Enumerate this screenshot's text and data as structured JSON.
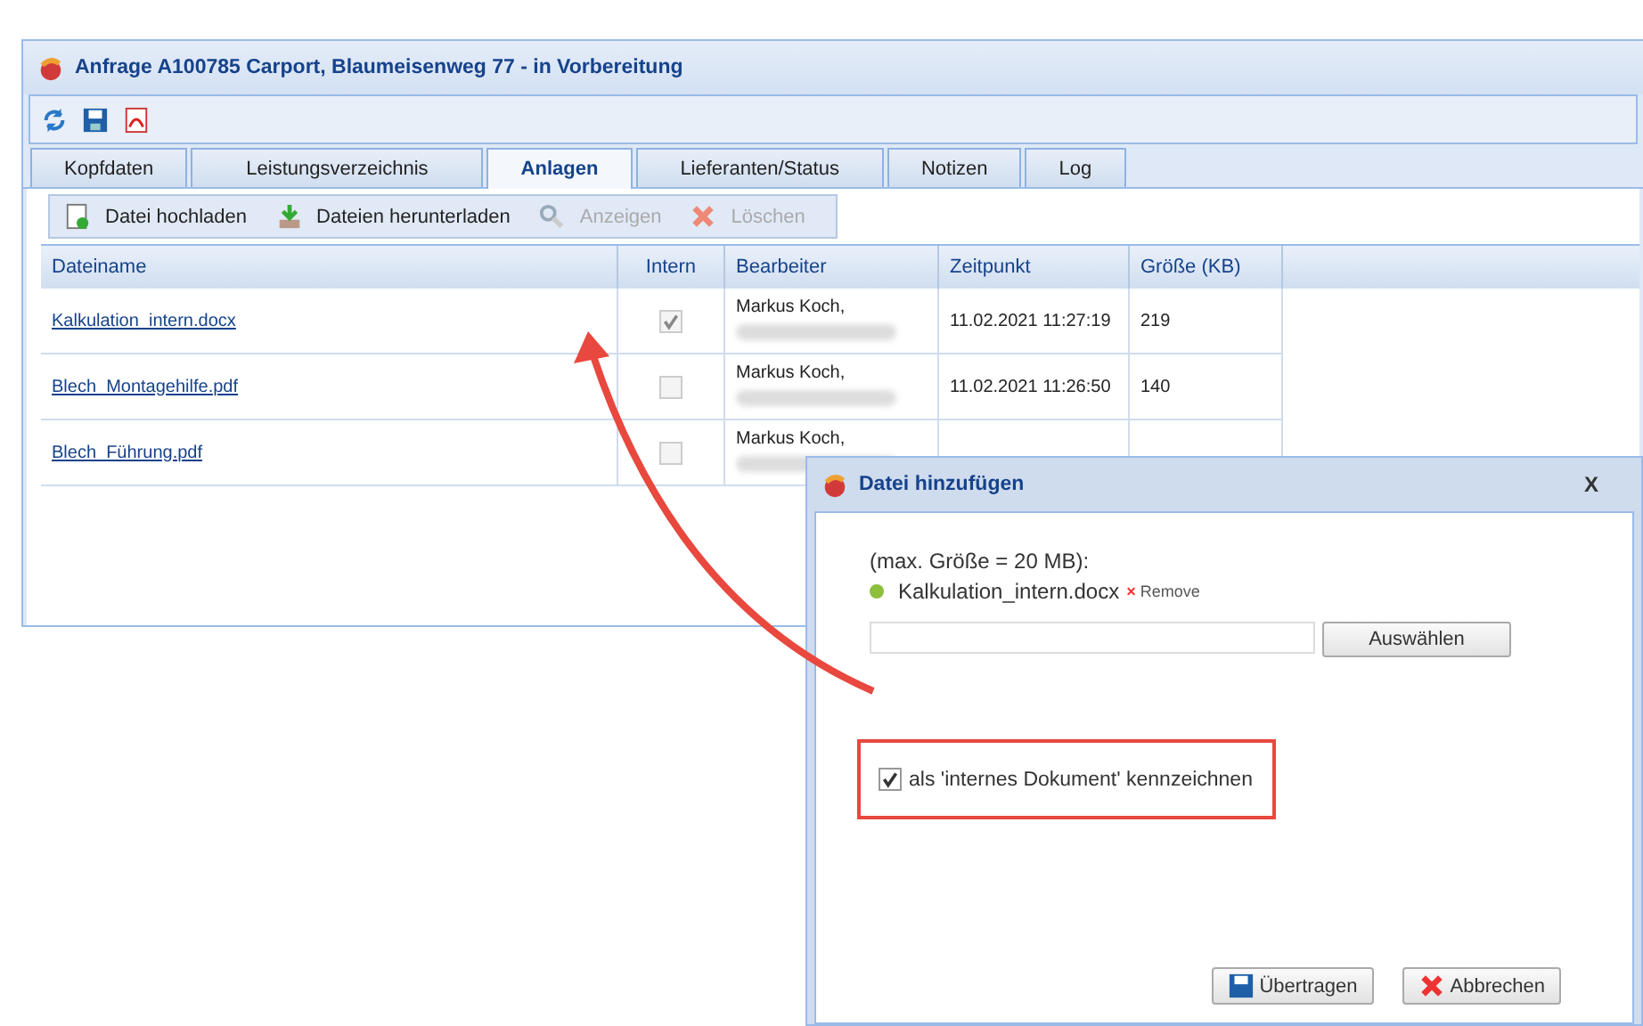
{
  "window": {
    "title": "Anfrage A100785 Carport, Blaumeisenweg 77 - in Vorbereitung"
  },
  "tabs": [
    {
      "label": "Kopfdaten",
      "selected": false
    },
    {
      "label": "Leistungsverzeichnis",
      "selected": false
    },
    {
      "label": "Anlagen",
      "selected": true
    },
    {
      "label": "Lieferanten/Status",
      "selected": false
    },
    {
      "label": "Notizen",
      "selected": false
    },
    {
      "label": "Log",
      "selected": false
    }
  ],
  "actions": [
    {
      "kind": "upload",
      "label": "Datei hochladen",
      "disabled": false
    },
    {
      "kind": "download",
      "label": "Dateien herunterladen",
      "disabled": false
    },
    {
      "kind": "view",
      "label": "Anzeigen",
      "disabled": true
    },
    {
      "kind": "delete",
      "label": "Löschen",
      "disabled": true
    }
  ],
  "table": {
    "columns": [
      "Dateiname",
      "Intern",
      "Bearbeiter",
      "Zeitpunkt",
      "Größe (KB)"
    ],
    "rows": [
      {
        "name": "Kalkulation_intern.docx",
        "checked": true,
        "editor": "Markus Koch,",
        "time": "11.02.2021 11:27:19",
        "size": "219"
      },
      {
        "name": "Blech_Montagehilfe.pdf",
        "checked": false,
        "editor": "Markus Koch,",
        "time": "11.02.2021 11:26:50",
        "size": "140"
      },
      {
        "name": "Blech_Führung.pdf",
        "checked": false,
        "editor": "Markus Koch,"
      }
    ]
  },
  "dialog": {
    "title": "Datei hinzufügen",
    "close": "X",
    "hint": "(max. Größe = 20 MB):",
    "file": "Kalkulation_intern.docx",
    "remove_icon": "×",
    "remove": "Remove",
    "choose": "Auswählen",
    "internal": {
      "label": "als 'internes Dokument' kennzeichnen",
      "checked": true
    },
    "ok": "Übertragen",
    "cancel": "Abbrechen"
  }
}
